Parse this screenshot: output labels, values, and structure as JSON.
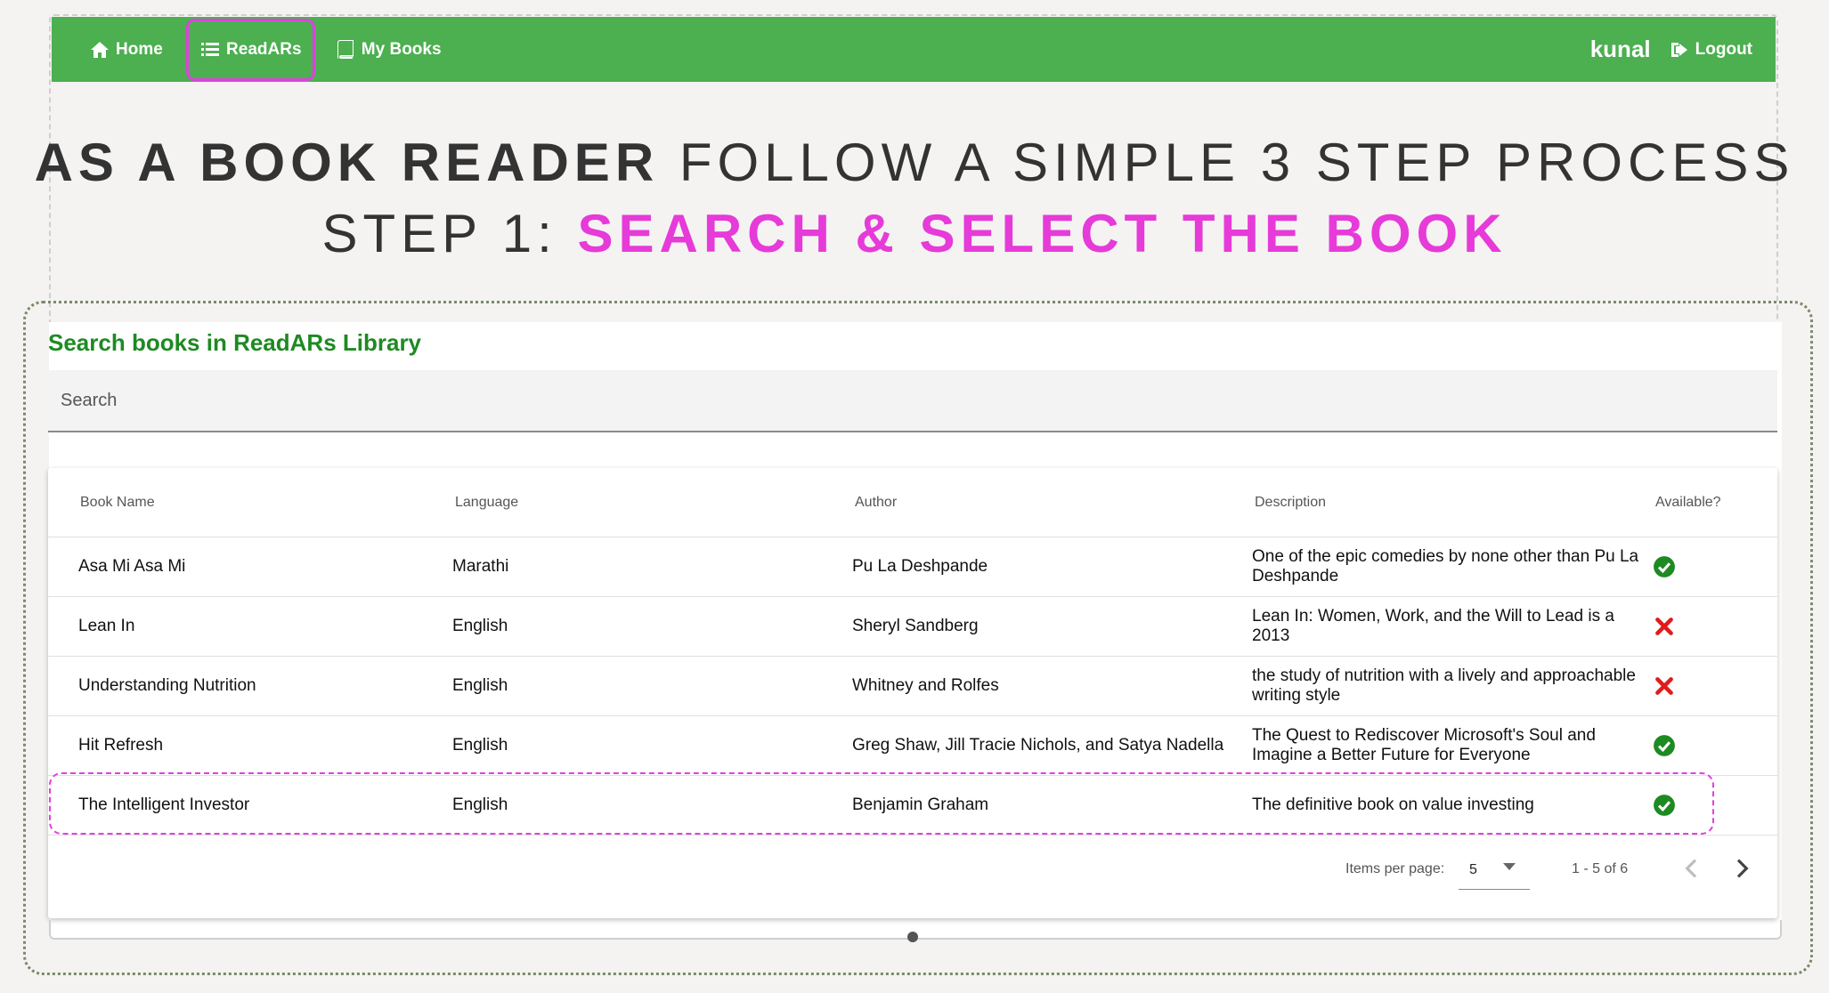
{
  "nav": {
    "home": "Home",
    "readars": "ReadARs",
    "mybooks": "My Books",
    "user": "kunal",
    "logout": "Logout"
  },
  "headline": {
    "bold": "AS A BOOK READER",
    "rest": "FOLLOW A SIMPLE 3 STEP PROCESS"
  },
  "subline": {
    "prefix": "STEP 1:",
    "accent": "SEARCH & SELECT THE BOOK"
  },
  "library": {
    "title": "Search books in ReadARs Library",
    "search_placeholder": "Search",
    "search_value": ""
  },
  "table": {
    "headers": [
      "Book Name",
      "Language",
      "Author",
      "Description",
      "Available?"
    ],
    "rows": [
      {
        "name": "Asa Mi Asa Mi",
        "language": "Marathi",
        "author": "Pu La Deshpande",
        "description": "One of the epic comedies by none other than Pu La Deshpande",
        "available": true
      },
      {
        "name": "Lean In",
        "language": "English",
        "author": "Sheryl Sandberg",
        "description": "Lean In: Women, Work, and the Will to Lead is a 2013",
        "available": false
      },
      {
        "name": "Understanding Nutrition",
        "language": "English",
        "author": "Whitney and Rolfes",
        "description": "the study of nutrition with a lively and approachable writing style",
        "available": false
      },
      {
        "name": "Hit Refresh",
        "language": "English",
        "author": "Greg Shaw, Jill Tracie Nichols, and Satya Nadella",
        "description": "The Quest to Rediscover Microsoft's Soul and Imagine a Better Future for Everyone",
        "available": true
      },
      {
        "name": "The Intelligent Investor",
        "language": "English",
        "author": "Benjamin Graham",
        "description": "The definitive book on value investing",
        "available": true
      }
    ]
  },
  "paginator": {
    "label": "Items per page:",
    "page_size": "5",
    "range": "1 - 5 of 6"
  },
  "colors": {
    "navbar": "#4caf50",
    "accent": "#e63ad9",
    "title_green": "#1e8a22",
    "available": "#1e8a22",
    "unavailable": "#e01b1b"
  },
  "icons": {
    "home": "home-icon",
    "readars": "list-icon",
    "mybooks": "book-icon",
    "logout": "logout-icon",
    "available": "check-circle-icon",
    "unavailable": "close-x-icon"
  }
}
